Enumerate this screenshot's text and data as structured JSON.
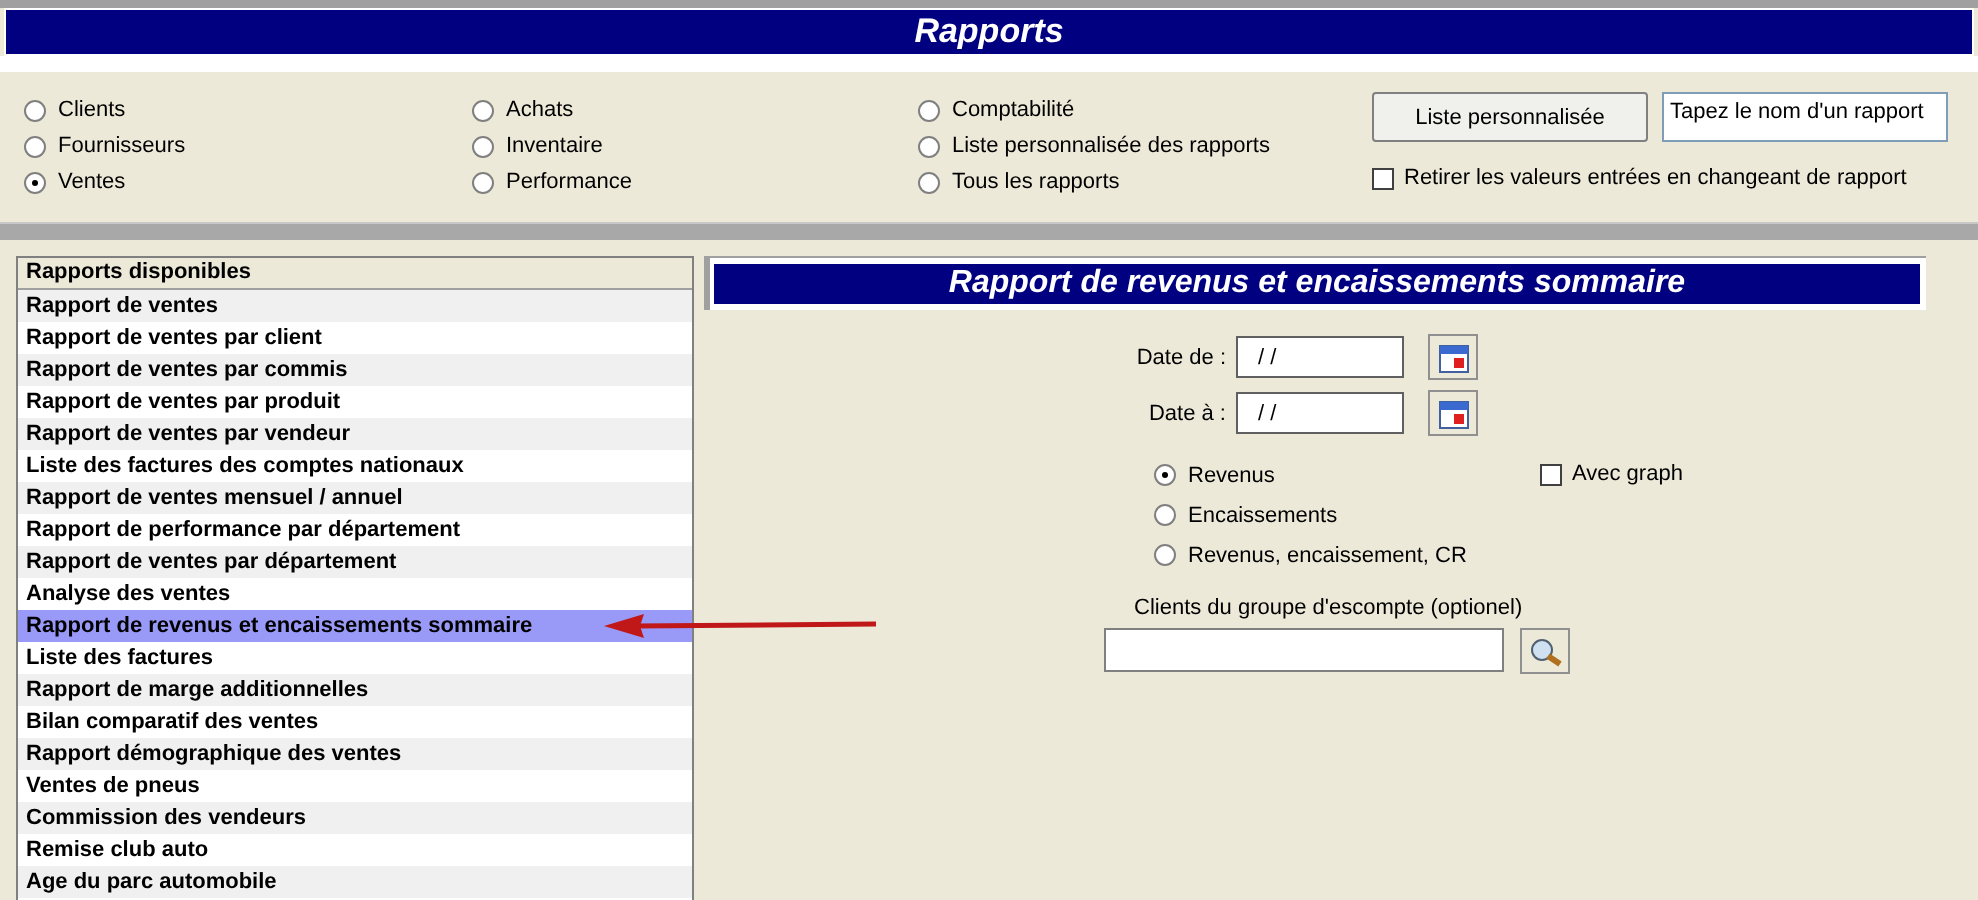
{
  "window": {
    "title": "Rapports"
  },
  "report_categories": [
    {
      "label": "Clients",
      "selected": false
    },
    {
      "label": "Fournisseurs",
      "selected": false
    },
    {
      "label": "Ventes",
      "selected": true
    },
    {
      "label": "Achats",
      "selected": false
    },
    {
      "label": "Inventaire",
      "selected": false
    },
    {
      "label": "Performance",
      "selected": false
    },
    {
      "label": "Comptabilité",
      "selected": false
    },
    {
      "label": "Liste personnalisée des rapports",
      "selected": false
    },
    {
      "label": "Tous les rapports",
      "selected": false
    }
  ],
  "custom_list_button": "Liste personnalisée",
  "report_name_field": {
    "value": "Tapez le nom d'un rapport"
  },
  "clear_values_checkbox": {
    "label": "Retirer les valeurs entrées en changeant de rapport",
    "checked": false
  },
  "report_list": {
    "header": "Rapports disponibles",
    "items": [
      {
        "label": "Rapport de ventes",
        "selected": false
      },
      {
        "label": "Rapport de ventes par client",
        "selected": false
      },
      {
        "label": "Rapport de ventes par commis",
        "selected": false
      },
      {
        "label": "Rapport de ventes par produit",
        "selected": false
      },
      {
        "label": "Rapport de ventes par vendeur",
        "selected": false
      },
      {
        "label": "Liste des factures des comptes nationaux",
        "selected": false
      },
      {
        "label": "Rapport de ventes mensuel / annuel",
        "selected": false
      },
      {
        "label": "Rapport de performance par département",
        "selected": false
      },
      {
        "label": "Rapport de ventes par département",
        "selected": false
      },
      {
        "label": "Analyse des ventes",
        "selected": false
      },
      {
        "label": "Rapport de revenus et encaissements sommaire",
        "selected": true
      },
      {
        "label": "Liste des factures",
        "selected": false
      },
      {
        "label": "Rapport de marge additionnelles",
        "selected": false
      },
      {
        "label": "Bilan comparatif des ventes",
        "selected": false
      },
      {
        "label": "Rapport démographique des ventes",
        "selected": false
      },
      {
        "label": "Ventes de pneus",
        "selected": false
      },
      {
        "label": "Commission des vendeurs",
        "selected": false
      },
      {
        "label": "Remise club auto",
        "selected": false
      },
      {
        "label": "Age du parc automobile",
        "selected": false
      }
    ]
  },
  "report_panel": {
    "title": "Rapport de revenus et encaissements sommaire",
    "date_fields": [
      {
        "label": "Date de :",
        "value": "/ /"
      },
      {
        "label": "Date à :",
        "value": "/ /"
      }
    ],
    "modes": [
      {
        "label": "Revenus",
        "selected": true
      },
      {
        "label": "Encaissements",
        "selected": false
      },
      {
        "label": "Revenus, encaissement, CR",
        "selected": false
      }
    ],
    "graph_checkbox": {
      "label": "Avec graph",
      "checked": false
    },
    "discount_group": {
      "label": "Clients du groupe d'escompte (optionel)"
    }
  }
}
